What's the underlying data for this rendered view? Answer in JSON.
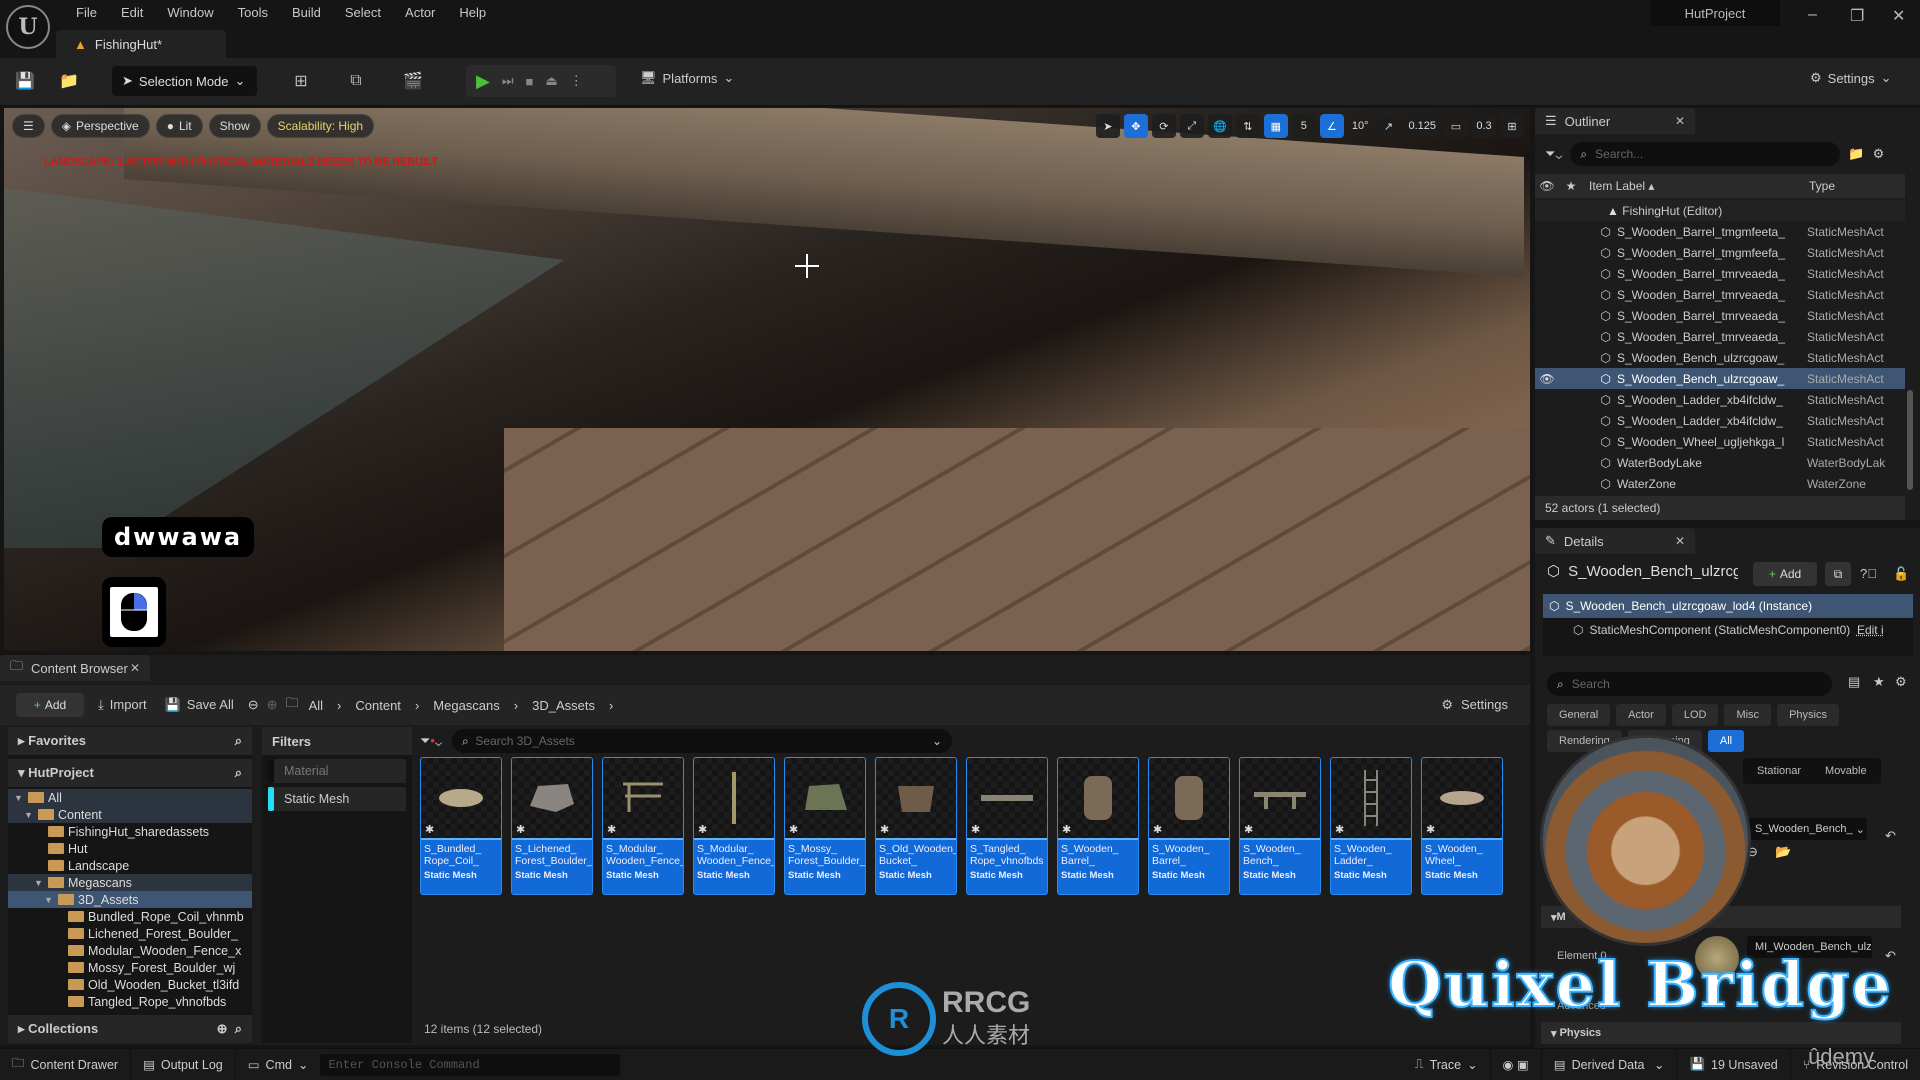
{
  "app": {
    "window_title": "HutProject",
    "document_tab": "FishingHut*",
    "menu": [
      "File",
      "Edit",
      "Window",
      "Tools",
      "Build",
      "Select",
      "Actor",
      "Help"
    ],
    "window_controls": {
      "minimize": "–",
      "restore": "❐",
      "close": "✕"
    }
  },
  "toolbar": {
    "selection_mode": "Selection Mode",
    "platforms": "Platforms",
    "settings": "Settings"
  },
  "viewport": {
    "view_mode": "Perspective",
    "lighting": "Lit",
    "show": "Show",
    "scalability": "Scalability: High",
    "warning": "LANDSCAPE: 1 ACTOR WITH PHYSICAL MATERIALS NEEDS TO BE REBUILT",
    "grid_snap": "5",
    "rotation_snap": "10°",
    "scale_snap": "0.125",
    "camera_speed": "0.3",
    "key_overlay": "dwwawa"
  },
  "outliner": {
    "title": "Outliner",
    "search_placeholder": "Search...",
    "col_label": "Item Label",
    "col_type": "Type",
    "root": "FishingHut (Editor)",
    "rows": [
      {
        "label": "S_Wooden_Barrel_tmgmfeeta_",
        "type": "StaticMeshAct",
        "selected": false
      },
      {
        "label": "S_Wooden_Barrel_tmgmfeefa_",
        "type": "StaticMeshAct",
        "selected": false
      },
      {
        "label": "S_Wooden_Barrel_tmrveaeda_",
        "type": "StaticMeshAct",
        "selected": false
      },
      {
        "label": "S_Wooden_Barrel_tmrveaeda_",
        "type": "StaticMeshAct",
        "selected": false
      },
      {
        "label": "S_Wooden_Barrel_tmrveaeda_",
        "type": "StaticMeshAct",
        "selected": false
      },
      {
        "label": "S_Wooden_Barrel_tmrveaeda_",
        "type": "StaticMeshAct",
        "selected": false
      },
      {
        "label": "S_Wooden_Bench_ulzrcgoaw_",
        "type": "StaticMeshAct",
        "selected": false
      },
      {
        "label": "S_Wooden_Bench_ulzrcgoaw_",
        "type": "StaticMeshAct",
        "selected": true
      },
      {
        "label": "S_Wooden_Ladder_xb4ifcldw_",
        "type": "StaticMeshAct",
        "selected": false
      },
      {
        "label": "S_Wooden_Ladder_xb4ifcldw_",
        "type": "StaticMeshAct",
        "selected": false
      },
      {
        "label": "S_Wooden_Wheel_ugljehkga_l",
        "type": "StaticMeshAct",
        "selected": false
      },
      {
        "label": "WaterBodyLake",
        "type": "WaterBodyLak",
        "selected": false
      },
      {
        "label": "WaterZone",
        "type": "WaterZone",
        "selected": false
      }
    ],
    "footer": "52 actors (1 selected)"
  },
  "details": {
    "title": "Details",
    "actor_name": "S_Wooden_Bench_ulzrcg",
    "add": "Add",
    "instance": "S_Wooden_Bench_ulzrcgoaw_lod4 (Instance)",
    "component": "StaticMeshComponent (StaticMeshComponent0)",
    "edit_link": "Edit i",
    "search_placeholder": "Search",
    "categories_row1": [
      "General",
      "Actor",
      "LOD",
      "Misc",
      "Physics"
    ],
    "categories_row2": [
      "Rendering",
      "Streaming",
      "All"
    ],
    "active_category": "All",
    "mobility": [
      "Stationar",
      "Movable"
    ],
    "static_mesh_value": "S_Wooden_Bench_",
    "materials_section": "M",
    "element_label": "Element 0",
    "material_value": "MI_Wooden_Bench_ulzrc",
    "advanced": "Advanced",
    "physics_section": "Physics"
  },
  "content_browser": {
    "title": "Content Browser",
    "add": "Add",
    "import": "Import",
    "save_all": "Save All",
    "breadcrumb": [
      "All",
      "Content",
      "Megascans",
      "3D_Assets"
    ],
    "settings": "Settings",
    "favorites": "Favorites",
    "project": "HutProject",
    "tree": [
      {
        "label": "All",
        "depth": 0,
        "open": true,
        "style": "hl"
      },
      {
        "label": "Content",
        "depth": 1,
        "open": true,
        "style": "hl"
      },
      {
        "label": "FishingHut_sharedassets",
        "depth": 2,
        "open": false,
        "style": ""
      },
      {
        "label": "Hut",
        "depth": 2,
        "open": false,
        "style": ""
      },
      {
        "label": "Landscape",
        "depth": 2,
        "open": false,
        "style": ""
      },
      {
        "label": "Megascans",
        "depth": 2,
        "open": true,
        "style": "hl"
      },
      {
        "label": "3D_Assets",
        "depth": 3,
        "open": true,
        "style": "sel"
      },
      {
        "label": "Bundled_Rope_Coil_vhnmb",
        "depth": 4,
        "open": false,
        "style": ""
      },
      {
        "label": "Lichened_Forest_Boulder_",
        "depth": 4,
        "open": false,
        "style": ""
      },
      {
        "label": "Modular_Wooden_Fence_x",
        "depth": 4,
        "open": false,
        "style": ""
      },
      {
        "label": "Mossy_Forest_Boulder_wj",
        "depth": 4,
        "open": false,
        "style": ""
      },
      {
        "label": "Old_Wooden_Bucket_tl3ifd",
        "depth": 4,
        "open": false,
        "style": ""
      },
      {
        "label": "Tangled_Rope_vhnofbds",
        "depth": 4,
        "open": false,
        "style": ""
      }
    ],
    "collections": "Collections",
    "filters_title": "Filters",
    "filters": [
      {
        "label": "Material",
        "color": "#101010",
        "dim": true
      },
      {
        "label": "Static Mesh",
        "color": "#22e0f0",
        "dim": false
      }
    ],
    "search_placeholder": "Search 3D_Assets",
    "assets": [
      {
        "name": "S_Bundled_ Rope_Coil_",
        "kind": "Static Mesh",
        "icon": "rope"
      },
      {
        "name": "S_Lichened_ Forest_Boulder_",
        "kind": "Static Mesh",
        "icon": "rock"
      },
      {
        "name": "S_Modular_ Wooden_Fence_",
        "kind": "Static Mesh",
        "icon": "fence"
      },
      {
        "name": "S_Modular_ Wooden_Fence_",
        "kind": "Static Mesh",
        "icon": "post"
      },
      {
        "name": "S_Mossy_ Forest_Boulder_",
        "kind": "Static Mesh",
        "icon": "mossrock"
      },
      {
        "name": "S_Old_Wooden_ Bucket_",
        "kind": "Static Mesh",
        "icon": "bucket"
      },
      {
        "name": "S_Tangled_ Rope_vhnofbds",
        "kind": "Static Mesh",
        "icon": "tangled"
      },
      {
        "name": "S_Wooden_ Barrel_",
        "kind": "Static Mesh",
        "icon": "barrel"
      },
      {
        "name": "S_Wooden_ Barrel_",
        "kind": "Static Mesh",
        "icon": "barrel"
      },
      {
        "name": "S_Wooden_ Bench_",
        "kind": "Static Mesh",
        "icon": "bench"
      },
      {
        "name": "S_Wooden_ Ladder_",
        "kind": "Static Mesh",
        "icon": "ladder"
      },
      {
        "name": "S_Wooden_ Wheel_",
        "kind": "Static Mesh",
        "icon": "wheel"
      }
    ],
    "count": "12 items (12 selected)"
  },
  "statusbar": {
    "content_drawer": "Content Drawer",
    "output_log": "Output Log",
    "cmd": "Cmd",
    "console_placeholder": "Enter Console Command",
    "trace": "Trace",
    "derived_data": "Derived Data",
    "unsaved": "19 Unsaved",
    "revision_control": "Revision Control"
  },
  "watermarks": {
    "quixel": "Quixel Bridge",
    "rrcg": "RRCG",
    "rrcg_sub": "人人素材",
    "udemy": "ûdemy"
  },
  "colors": {
    "accent_blue": "#1c6fd6",
    "selection": "#3e5673",
    "warning_red": "#cc1a1a",
    "scalability_yellow": "#e6d56a",
    "play_green": "#4bbf3a",
    "folder": "#c99a55"
  }
}
